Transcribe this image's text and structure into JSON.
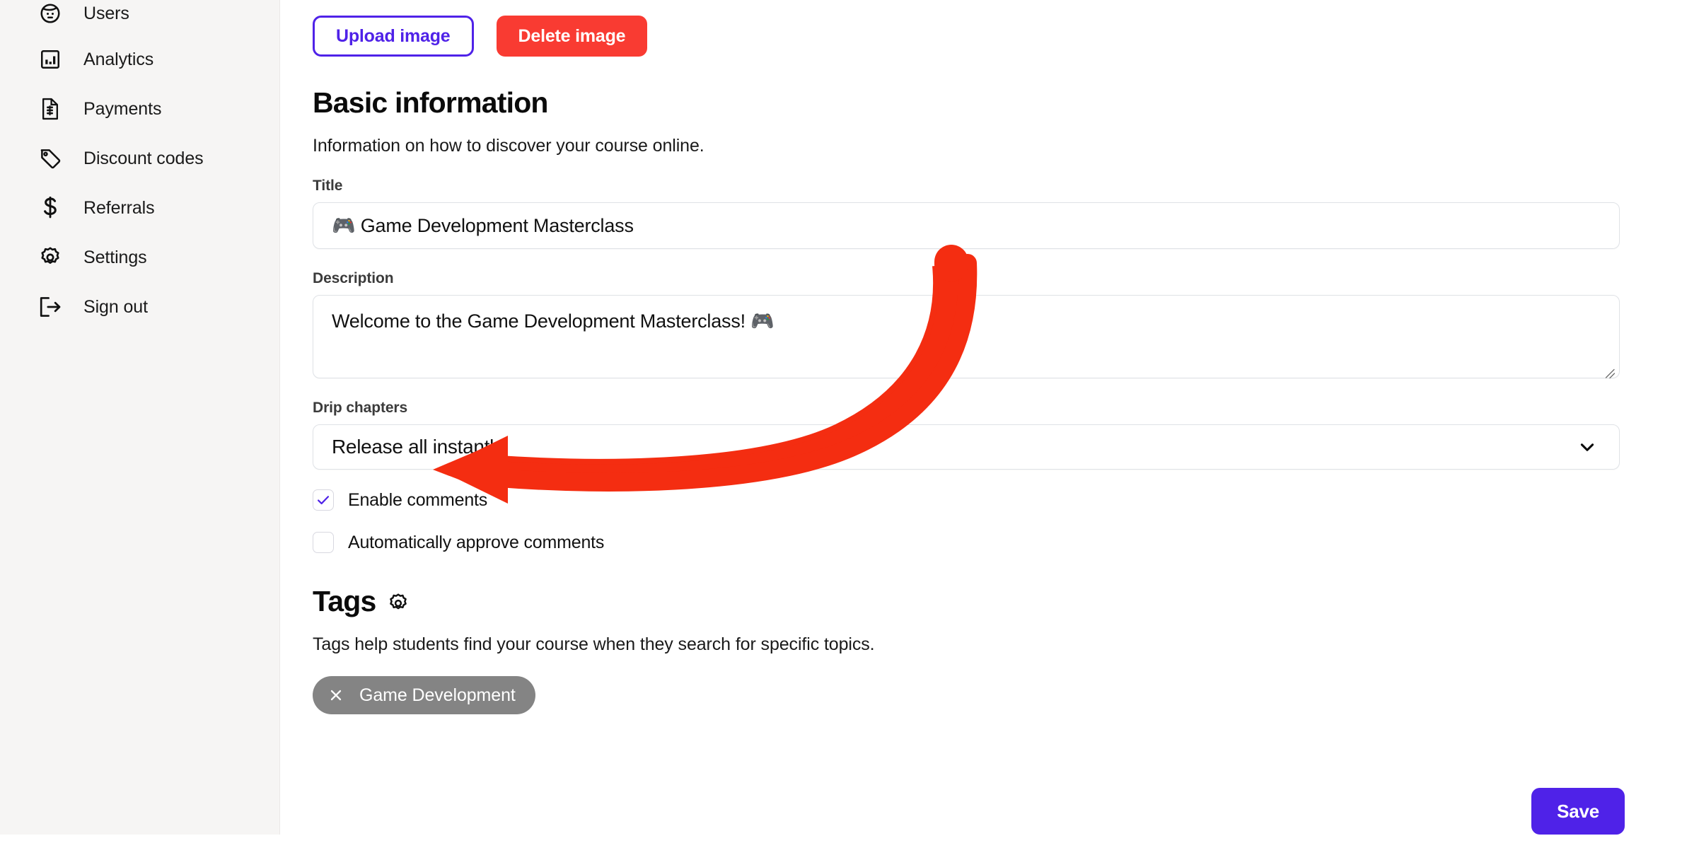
{
  "sidebar": {
    "items": [
      {
        "label": "Users",
        "icon": "user-circle-icon"
      },
      {
        "label": "Analytics",
        "icon": "chart-bar-icon"
      },
      {
        "label": "Payments",
        "icon": "invoice-dollar-icon"
      },
      {
        "label": "Discount codes",
        "icon": "tag-icon"
      },
      {
        "label": "Referrals",
        "icon": "dollar-sign-icon"
      },
      {
        "label": "Settings",
        "icon": "gear-icon"
      },
      {
        "label": "Sign out",
        "icon": "sign-out-icon"
      }
    ]
  },
  "toolbar": {
    "upload_label": "Upload image",
    "delete_label": "Delete image"
  },
  "basic": {
    "heading": "Basic information",
    "description": "Information on how to discover your course online.",
    "title_label": "Title",
    "title_value": "🎮 Game Development Masterclass",
    "description_label": "Description",
    "description_value": "Welcome to the Game Development Masterclass! 🎮",
    "drip_label": "Drip chapters",
    "drip_value": "Release all instantly",
    "drip_options": [
      "Release all instantly"
    ],
    "enable_comments_label": "Enable comments",
    "enable_comments_checked": true,
    "auto_approve_label": "Automatically approve comments",
    "auto_approve_checked": false
  },
  "tags": {
    "heading": "Tags",
    "description": "Tags help students find your course when they search for specific topics.",
    "chips": [
      {
        "label": "Game Development",
        "remove_icon": "close-icon"
      }
    ]
  },
  "footer": {
    "save_label": "Save"
  },
  "annotation": {
    "type": "curved-arrow",
    "color": "#f42d11",
    "points_to": "Drip chapters"
  },
  "colors": {
    "accent_purple": "#4f22e8",
    "danger_red": "#f93b32",
    "annotation_red": "#f42d11",
    "sidebar_bg": "#f6f5f4",
    "chip_gray": "#848484",
    "field_border": "#dfe2e6"
  }
}
